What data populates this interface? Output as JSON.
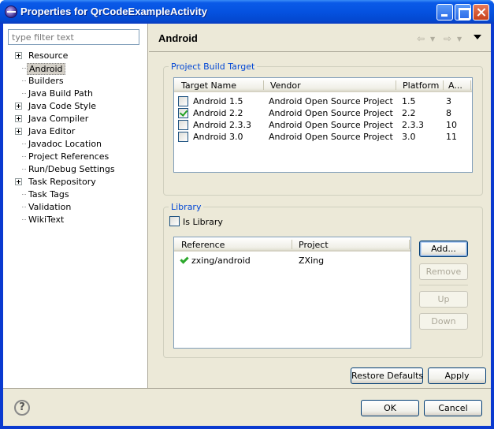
{
  "window": {
    "title": "Properties for QrCodeExampleActivity"
  },
  "filter": {
    "placeholder": "type filter text"
  },
  "tree": [
    {
      "label": "Resource",
      "expandable": true,
      "selected": false
    },
    {
      "label": "Android",
      "expandable": false,
      "selected": true
    },
    {
      "label": "Builders",
      "expandable": false,
      "selected": false
    },
    {
      "label": "Java Build Path",
      "expandable": false,
      "selected": false
    },
    {
      "label": "Java Code Style",
      "expandable": true,
      "selected": false
    },
    {
      "label": "Java Compiler",
      "expandable": true,
      "selected": false
    },
    {
      "label": "Java Editor",
      "expandable": true,
      "selected": false
    },
    {
      "label": "Javadoc Location",
      "expandable": false,
      "selected": false
    },
    {
      "label": "Project References",
      "expandable": false,
      "selected": false
    },
    {
      "label": "Run/Debug Settings",
      "expandable": false,
      "selected": false
    },
    {
      "label": "Task Repository",
      "expandable": true,
      "selected": false
    },
    {
      "label": "Task Tags",
      "expandable": false,
      "selected": false
    },
    {
      "label": "Validation",
      "expandable": false,
      "selected": false
    },
    {
      "label": "WikiText",
      "expandable": false,
      "selected": false
    }
  ],
  "page": {
    "title": "Android"
  },
  "build_target": {
    "group_label": "Project Build Target",
    "columns": [
      "Target Name",
      "Vendor",
      "Platform",
      "A..."
    ],
    "rows": [
      {
        "checked": false,
        "name": "Android 1.5",
        "vendor": "Android Open Source Project",
        "platform": "1.5",
        "api": "3"
      },
      {
        "checked": true,
        "name": "Android 2.2",
        "vendor": "Android Open Source Project",
        "platform": "2.2",
        "api": "8"
      },
      {
        "checked": false,
        "name": "Android 2.3.3",
        "vendor": "Android Open Source Project",
        "platform": "2.3.3",
        "api": "10"
      },
      {
        "checked": false,
        "name": "Android 3.0",
        "vendor": "Android Open Source Project",
        "platform": "3.0",
        "api": "11"
      }
    ]
  },
  "library": {
    "group_label": "Library",
    "is_library_label": "Is Library",
    "is_library_checked": false,
    "columns": [
      "Reference",
      "Project"
    ],
    "rows": [
      {
        "reference": "zxing/android",
        "project": "ZXing",
        "status": "valid"
      }
    ],
    "buttons": {
      "add": "Add...",
      "remove": "Remove",
      "up": "Up",
      "down": "Down"
    }
  },
  "actions": {
    "restore_defaults": "Restore Defaults",
    "apply": "Apply",
    "ok": "OK",
    "cancel": "Cancel",
    "help": "?"
  },
  "colors": {
    "group_title": "#0046d5",
    "title_bar": "#0552e0",
    "check_mark": "#21a121"
  }
}
